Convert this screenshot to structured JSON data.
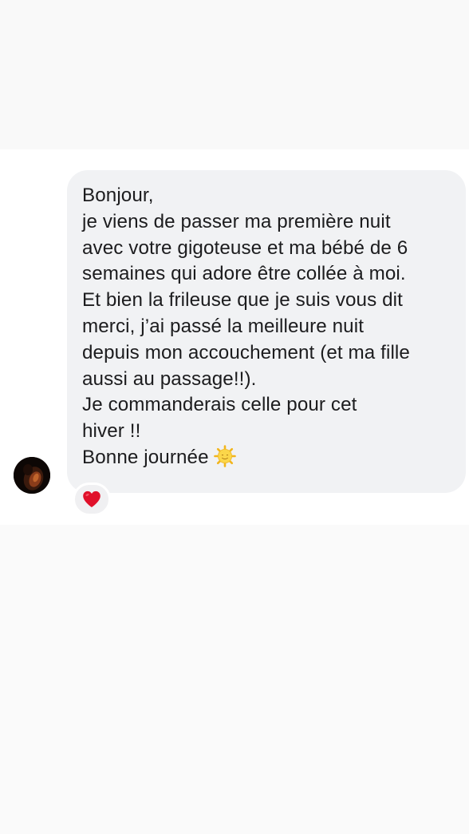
{
  "message": {
    "lines": [
      "Bonjour,",
      "je viens de passer ma première nuit",
      "avec votre gigoteuse et ma bébé de 6",
      "semaines qui adore être collée à moi.",
      "Et bien la frileuse que je suis vous dit",
      "merci, j’ai passé la meilleure nuit",
      "depuis mon accouchement (et ma fille",
      "aussi au passage!!).",
      "Je commanderais celle pour cet",
      "hiver !!",
      "Bonne journée"
    ],
    "trailing_icon": "sun-with-face-emoji",
    "bubble_color": "#f1f2f4",
    "text_color": "#1c1c1e"
  },
  "sender": {
    "avatar_icon": "profile-photo"
  },
  "reaction": {
    "icon": "red-heart-emoji",
    "color": "#e0102a"
  }
}
